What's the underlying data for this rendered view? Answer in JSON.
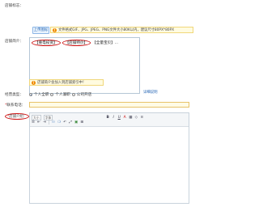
{
  "fields": {
    "store_logo_label": "店铺标志：",
    "store_intro_label": "店铺简介：",
    "business_type_label": "经营类型：",
    "contact_label": "联系电话：",
    "store_desc_label": "店铺介绍："
  },
  "logo": {
    "upload_button": "上传图标",
    "tip": "文件格式GIF、JPG、JPEG、PNG文件大小80K以内，建议尺寸80PX*80PX"
  },
  "intro": {
    "tags": [
      "【重电投资】",
      "【店铺特价】",
      "【全量宝贝】..."
    ],
    "detail_link": "详细说明",
    "tip": "店铺简介会加入到店铺索引中！"
  },
  "business_type": {
    "options": [
      "个人全职",
      "个人兼职",
      "公司开店"
    ],
    "selected_index": 0
  },
  "contact": {
    "value": ""
  },
  "editor": {
    "font_size_select": "大小",
    "font_family_select": "字体",
    "row1_buttons": [
      "B",
      "I",
      "U",
      "A",
      "▦",
      "◇",
      "≡"
    ],
    "row2_buttons": [
      "☰",
      "⇤",
      "⇥",
      "⚇",
      "❍",
      "↶",
      "⤢",
      "▣",
      "⊞"
    ]
  },
  "colors": {
    "accent": "#2767b5",
    "tip_bg": "#fffbe0",
    "warn": "#f08a00",
    "circle": "#cc1111"
  }
}
